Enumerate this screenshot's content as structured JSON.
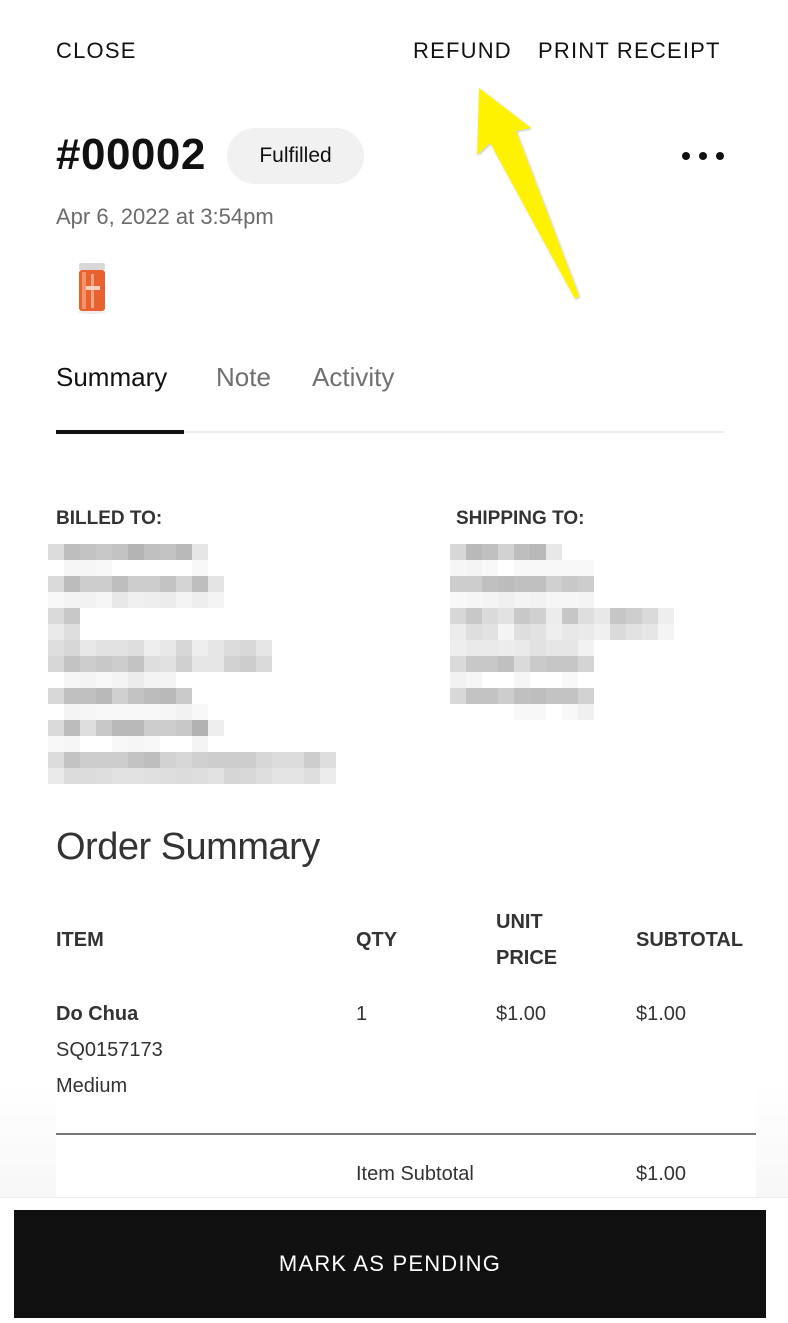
{
  "header": {
    "close_label": "CLOSE",
    "refund_label": "REFUND",
    "print_receipt_label": "PRINT RECEIPT",
    "more_icon": "more-horizontal-icon"
  },
  "order": {
    "number": "#00002",
    "status": "Fulfilled",
    "date": "Apr 6, 2022 at 3:54pm",
    "product_thumbnail": "pickled-vegetables-jar-image"
  },
  "tabs": [
    {
      "label": "Summary",
      "active": true
    },
    {
      "label": "Note",
      "active": false
    },
    {
      "label": "Activity",
      "active": false
    }
  ],
  "addresses": {
    "billed_to_label": "BILLED TO:",
    "shipping_to_label": "SHIPPING TO:",
    "billed_to_value": "[pixelated / redacted]",
    "shipping_to_value": "[pixelated / redacted]"
  },
  "order_summary": {
    "title": "Order Summary",
    "columns": [
      "ITEM",
      "QTY",
      "UNIT PRICE",
      "SUBTOTAL"
    ],
    "column_unit_price_line1": "UNIT",
    "column_unit_price_line2": "PRICE",
    "items": [
      {
        "name": "Do Chua",
        "sku": "SQ0157173",
        "variant": "Medium",
        "qty": "1",
        "unit_price": "$1.00",
        "subtotal": "$1.00"
      }
    ],
    "item_subtotal_label": "Item Subtotal",
    "item_subtotal_value": "$1.00"
  },
  "footer": {
    "primary_button_label": "MARK AS PENDING"
  },
  "annotation": {
    "type": "arrow",
    "color": "#fff200",
    "points_to": "REFUND"
  }
}
